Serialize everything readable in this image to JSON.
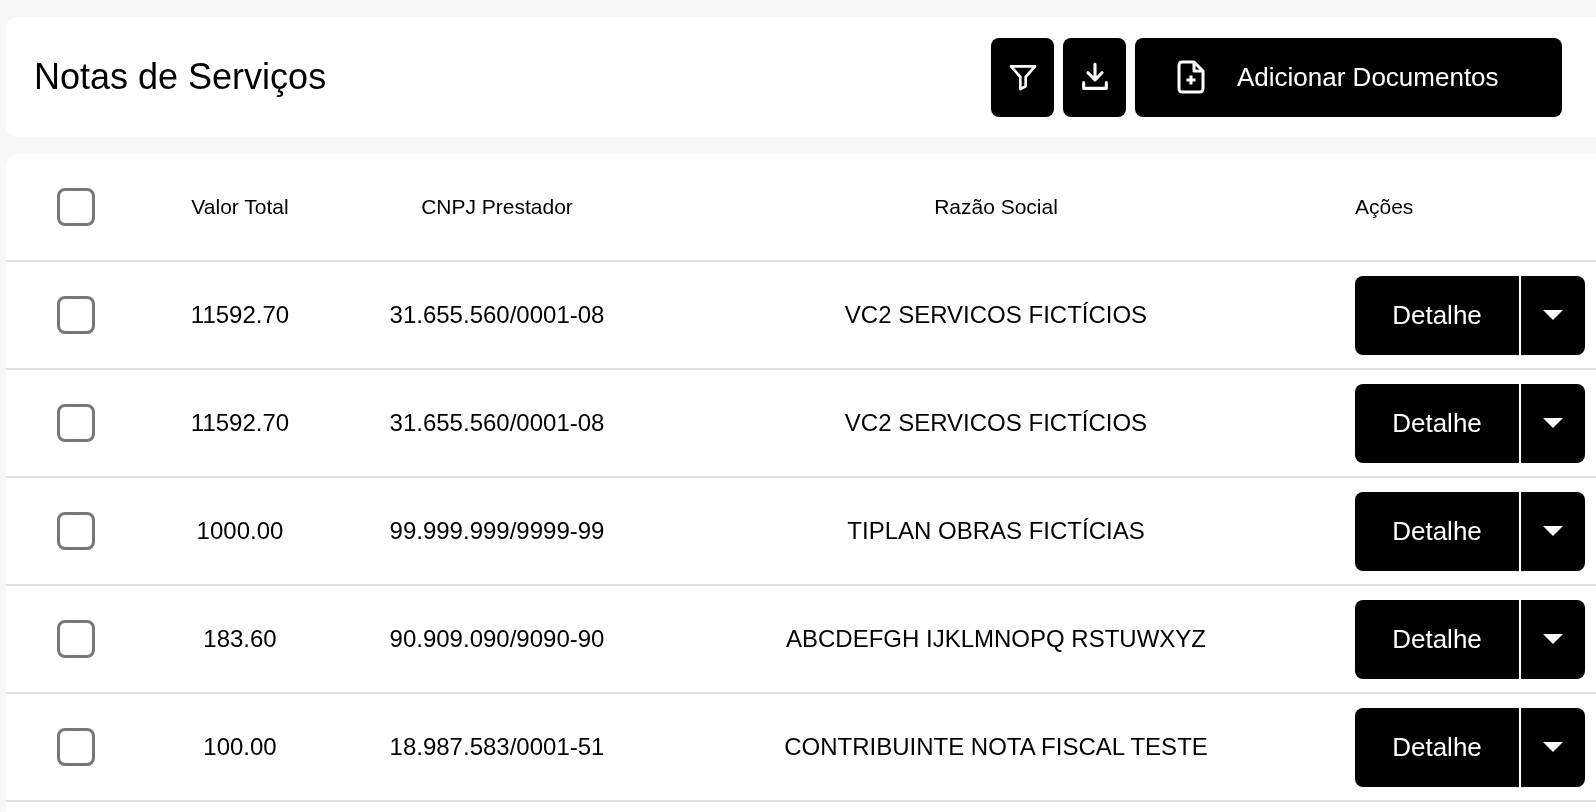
{
  "header": {
    "title": "Notas de Serviços",
    "add_button": "Adicionar Documentos"
  },
  "table": {
    "select_all": {
      "checked": false
    },
    "columns": [
      "Valor Total",
      "CNPJ Prestador",
      "Razão Social",
      "Ações"
    ],
    "rows": [
      {
        "checked": false,
        "valor_total": "11592.70",
        "cnpj": "31.655.560/0001-08",
        "razao_social": "VC2 SERVICOS FICTÍCIOS",
        "action": "Detalhe"
      },
      {
        "checked": false,
        "valor_total": "11592.70",
        "cnpj": "31.655.560/0001-08",
        "razao_social": "VC2 SERVICOS FICTÍCIOS",
        "action": "Detalhe"
      },
      {
        "checked": false,
        "valor_total": "1000.00",
        "cnpj": "99.999.999/9999-99",
        "razao_social": "TIPLAN OBRAS FICTÍCIAS",
        "action": "Detalhe"
      },
      {
        "checked": false,
        "valor_total": "183.60",
        "cnpj": "90.909.090/9090-90",
        "razao_social": "ABCDEFGH IJKLMNOPQ RSTUWXYZ",
        "action": "Detalhe"
      },
      {
        "checked": false,
        "valor_total": "100.00",
        "cnpj": "18.987.583/0001-51",
        "razao_social": "CONTRIBUINTE NOTA FISCAL TESTE",
        "action": "Detalhe"
      }
    ]
  }
}
